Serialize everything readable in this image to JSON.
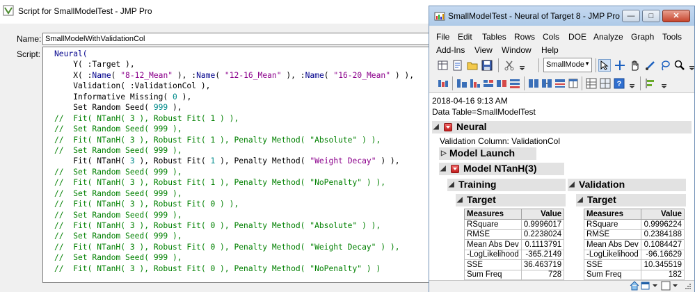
{
  "script_window": {
    "title": "Script for SmallModelTest - JMP Pro",
    "name_label": "Name:",
    "name_value": "SmallModelWithValidationCol",
    "script_label": "Script:",
    "code_lines": [
      [
        {
          "t": "Neural(",
          "c": "kw"
        }
      ],
      [
        {
          "t": "    Y( :Target ),",
          "c": "plain"
        }
      ],
      [
        {
          "t": "    X( :",
          "c": "plain"
        },
        {
          "t": "Name",
          "c": "kw"
        },
        {
          "t": "( ",
          "c": "plain"
        },
        {
          "t": "\"8-12_Mean\"",
          "c": "str"
        },
        {
          "t": " ), :",
          "c": "plain"
        },
        {
          "t": "Name",
          "c": "kw"
        },
        {
          "t": "( ",
          "c": "plain"
        },
        {
          "t": "\"12-16_Mean\"",
          "c": "str"
        },
        {
          "t": " ), :",
          "c": "plain"
        },
        {
          "t": "Name",
          "c": "kw"
        },
        {
          "t": "( ",
          "c": "plain"
        },
        {
          "t": "\"16-20_Mean\"",
          "c": "str"
        },
        {
          "t": " ) ),",
          "c": "plain"
        }
      ],
      [
        {
          "t": "    Validation( :ValidationCol ),",
          "c": "plain"
        }
      ],
      [
        {
          "t": "    Informative Missing( ",
          "c": "plain"
        },
        {
          "t": "0",
          "c": "num"
        },
        {
          "t": " ),",
          "c": "plain"
        }
      ],
      [
        {
          "t": "    Set Random Seed( ",
          "c": "plain"
        },
        {
          "t": "999",
          "c": "num"
        },
        {
          "t": " ),",
          "c": "plain"
        }
      ],
      [
        {
          "t": "//  Fit( NTanH( 3 ), Robust Fit( 1 ) ),",
          "c": "cmt"
        }
      ],
      [
        {
          "t": "//  Set Random Seed( 999 ),",
          "c": "cmt"
        }
      ],
      [
        {
          "t": "//  Fit( NTanH( 3 ), Robust Fit( 1 ), Penalty Method( \"Absolute\" ) ),",
          "c": "cmt"
        }
      ],
      [
        {
          "t": "//  Set Random Seed( 999 ),",
          "c": "cmt"
        }
      ],
      [
        {
          "t": "    Fit( NTanH( ",
          "c": "plain"
        },
        {
          "t": "3",
          "c": "num"
        },
        {
          "t": " ), Robust Fit( ",
          "c": "plain"
        },
        {
          "t": "1",
          "c": "num"
        },
        {
          "t": " ), Penalty Method( ",
          "c": "plain"
        },
        {
          "t": "\"Weight Decay\"",
          "c": "str"
        },
        {
          "t": " ) ),",
          "c": "plain"
        }
      ],
      [
        {
          "t": "//  Set Random Seed( 999 ),",
          "c": "cmt"
        }
      ],
      [
        {
          "t": "//  Fit( NTanH( 3 ), Robust Fit( 1 ), Penalty Method( \"NoPenalty\" ) ),",
          "c": "cmt"
        }
      ],
      [
        {
          "t": "//  Set Random Seed( 999 ),",
          "c": "cmt"
        }
      ],
      [
        {
          "t": "//  Fit( NTanH( 3 ), Robust Fit( 0 ) ),",
          "c": "cmt"
        }
      ],
      [
        {
          "t": "//  Set Random Seed( 999 ),",
          "c": "cmt"
        }
      ],
      [
        {
          "t": "//  Fit( NTanH( 3 ), Robust Fit( 0 ), Penalty Method( \"Absolute\" ) ),",
          "c": "cmt"
        }
      ],
      [
        {
          "t": "//  Set Random Seed( 999 ),",
          "c": "cmt"
        }
      ],
      [
        {
          "t": "//  Fit( NTanH( 3 ), Robust Fit( 0 ), Penalty Method( \"Weight Decay\" ) ),",
          "c": "cmt"
        }
      ],
      [
        {
          "t": "//  Set Random Seed( 999 ),",
          "c": "cmt"
        }
      ],
      [
        {
          "t": "//  Fit( NTanH( 3 ), Robust Fit( 0 ), Penalty Method( \"NoPenalty\" ) )",
          "c": "cmt"
        }
      ],
      [
        {
          "t": "",
          "c": "plain"
        }
      ],
      [
        {
          "t": ");",
          "c": "plain"
        }
      ]
    ]
  },
  "report_window": {
    "title": "SmallModelTest - Neural of Target 8 - JMP Pro",
    "window_buttons": [
      "minimize",
      "maximize",
      "close"
    ],
    "menus_row1": [
      "File",
      "Edit",
      "Tables",
      "Rows",
      "Cols",
      "DOE",
      "Analyze",
      "Graph",
      "Tools"
    ],
    "menus_row2": [
      "Add-Ins",
      "View",
      "Window",
      "Help"
    ],
    "toolbar_combo_value": "SmallMode",
    "timestamp": "2018-04-16 9:13 AM",
    "data_table": "Data Table=SmallModelTest",
    "neural_header": "Neural",
    "validation_column": "Validation Column: ValidationCol",
    "model_launch": "Model Launch",
    "model_header": "Model NTanH(3)",
    "training": {
      "header": "Training",
      "target": "Target",
      "col_measures": "Measures",
      "col_value": "Value",
      "rows": [
        [
          "RSquare",
          "0.9996017"
        ],
        [
          "RMSE",
          "0.2238024"
        ],
        [
          "Mean Abs Dev",
          "0.1113791"
        ],
        [
          "-LogLikelihood",
          "-365.2149"
        ],
        [
          "SSE",
          "36.463719"
        ],
        [
          "Sum Freq",
          "728"
        ]
      ]
    },
    "validation": {
      "header": "Validation",
      "target": "Target",
      "col_measures": "Measures",
      "col_value": "Value",
      "rows": [
        [
          "RSquare",
          "0.9996224"
        ],
        [
          "RMSE",
          "0.2384188"
        ],
        [
          "Mean Abs Dev",
          "0.1084427"
        ],
        [
          "-LogLikelihood",
          "-96.16629"
        ],
        [
          "SSE",
          "10.345519"
        ],
        [
          "Sum Freq",
          "182"
        ]
      ]
    }
  }
}
